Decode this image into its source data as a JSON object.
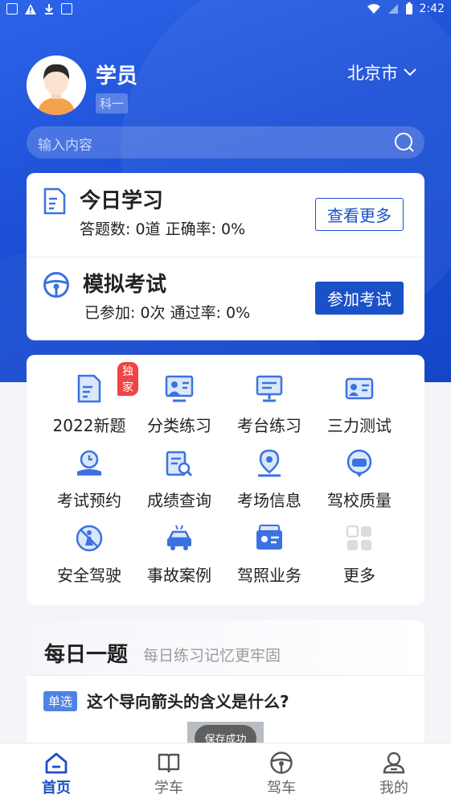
{
  "status_bar": {
    "time": "2:42"
  },
  "header": {
    "username": "学员",
    "subject": "科一",
    "city": "北京市",
    "search_placeholder": "输入内容"
  },
  "study": {
    "today": {
      "title": "今日学习",
      "stats": "答题数: 0道   正确率: 0%",
      "button": "查看更多"
    },
    "exam": {
      "title": "模拟考试",
      "stats": "已参加: 0次   通过率: 0%",
      "button": "参加考试"
    }
  },
  "grid": {
    "items": [
      {
        "label": "2022新题",
        "icon": "new-questions-icon",
        "badge": "独家"
      },
      {
        "label": "分类练习",
        "icon": "category-practice-icon"
      },
      {
        "label": "考台练习",
        "icon": "exam-desk-icon"
      },
      {
        "label": "三力测试",
        "icon": "three-ability-icon"
      },
      {
        "label": "考试预约",
        "icon": "exam-booking-icon"
      },
      {
        "label": "成绩查询",
        "icon": "score-query-icon"
      },
      {
        "label": "考场信息",
        "icon": "exam-site-icon"
      },
      {
        "label": "驾校质量",
        "icon": "school-quality-icon"
      },
      {
        "label": "安全驾驶",
        "icon": "safe-driving-icon"
      },
      {
        "label": "事故案例",
        "icon": "accident-case-icon"
      },
      {
        "label": "驾照业务",
        "icon": "license-service-icon"
      },
      {
        "label": "更多",
        "icon": "more-icon"
      }
    ]
  },
  "daily": {
    "title": "每日一题",
    "subtitle": "每日练习记忆更牢固",
    "question_type": "单选",
    "question": "这个导向箭头的含义是什么?"
  },
  "toast": "保存成功",
  "tabs": [
    {
      "label": "首页",
      "icon": "home-icon",
      "active": true
    },
    {
      "label": "学车",
      "icon": "book-icon",
      "active": false
    },
    {
      "label": "驾车",
      "icon": "steering-wheel-icon",
      "active": false
    },
    {
      "label": "我的",
      "icon": "profile-icon",
      "active": false
    }
  ],
  "colors": {
    "primary": "#1a50c8",
    "badge": "#ee4444"
  }
}
